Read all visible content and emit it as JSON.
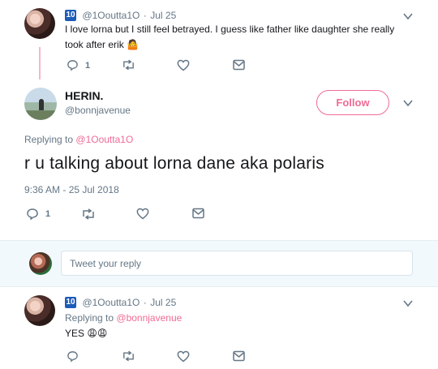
{
  "tweet1": {
    "badge": "10",
    "handle": "@1Ooutta1O",
    "sep": "·",
    "date": "Jul 25",
    "text": "I love lorna but I still feel betrayed. I guess like father like daughter she really took after erik",
    "emoji": "🤷",
    "reply_count": "1"
  },
  "focused": {
    "name": "HERIN.",
    "handle": "@bonnjavenue",
    "follow_label": "Follow",
    "replying_prefix": "Replying to",
    "replying_to": "@1Ooutta1O",
    "text": "r u talking about lorna dane aka polaris",
    "timestamp": "9:36 AM - 25 Jul 2018",
    "reply_count": "1"
  },
  "composer": {
    "placeholder": "Tweet your reply"
  },
  "tweet3": {
    "badge": "10",
    "handle": "@1Ooutta1O",
    "sep": "·",
    "date": "Jul 25",
    "replying_prefix": "Replying to",
    "replying_to": "@bonnjavenue",
    "text": "YES",
    "emoji": "😩😩"
  },
  "colors": {
    "accent": "#f06b94",
    "muted": "#657786",
    "badge": "#1d5cb8"
  },
  "icons": [
    "reply-icon",
    "retweet-icon",
    "like-icon",
    "dm-icon",
    "chevron-down-icon"
  ]
}
